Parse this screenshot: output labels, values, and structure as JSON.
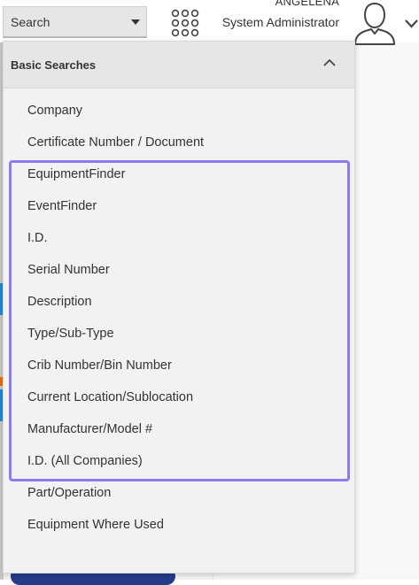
{
  "header": {
    "search_select": {
      "value": "Search",
      "icon": "caret-down-icon"
    },
    "apps_icon": "apps-grid-icon",
    "user": {
      "name": "ANGELENA",
      "role": "System Administrator",
      "avatar_icon": "user-avatar-icon",
      "menu_icon": "chevron-down-icon"
    }
  },
  "dropdown": {
    "section_title": "Basic Searches",
    "collapse_icon": "chevron-up-icon",
    "options": [
      "Company",
      "Certificate Number / Document",
      "EquipmentFinder",
      "EventFinder",
      "I.D.",
      "Serial Number",
      "Description",
      "Type/Sub-Type",
      "Crib Number/Bin Number",
      "Current Location/Sublocation",
      "Manufacturer/Model #",
      "I.D. (All Companies)",
      "Part/Operation",
      "Equipment Where Used"
    ],
    "highlight_color": "#8a7cf0"
  },
  "colors": {
    "panel_background": "#f2f2f2",
    "header_background": "#e6e6e6",
    "text": "#333333",
    "highlight": "#8a7cf0"
  }
}
